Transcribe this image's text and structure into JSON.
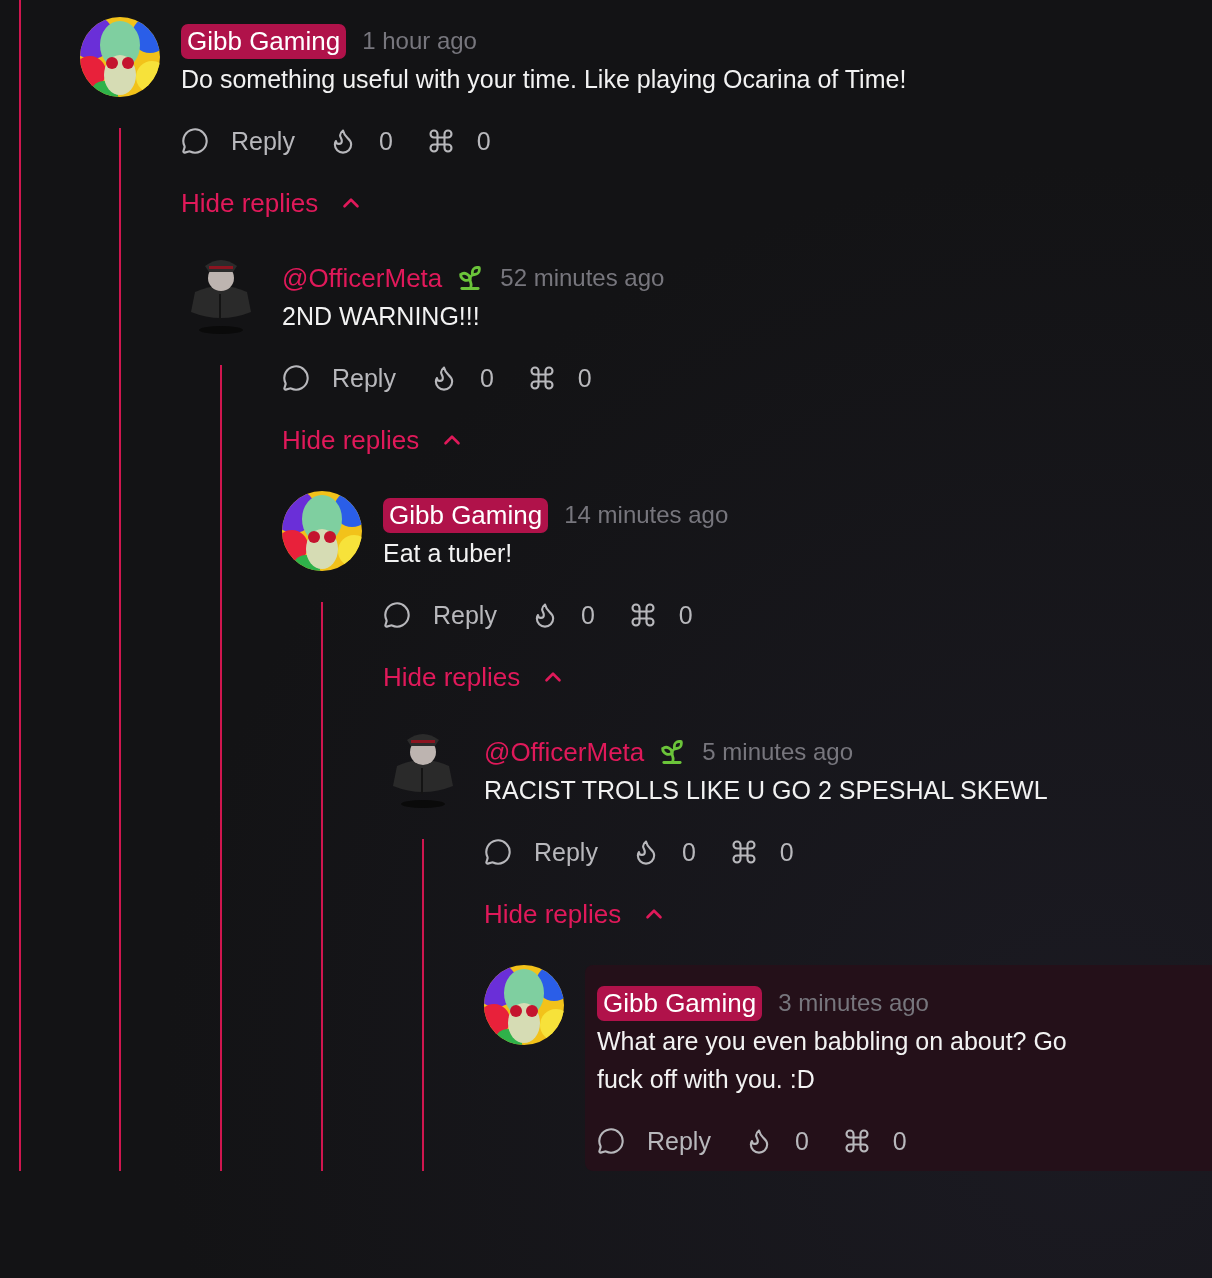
{
  "comments": [
    {
      "author": "Gibb Gaming",
      "kind": "op",
      "time": "1 hour ago",
      "text": "Do something useful with your time. Like playing Ocarina of Time!",
      "reply_label": "Reply",
      "flames": "0",
      "commands": "0",
      "highlighted": false,
      "toggle": {
        "label": "Hide replies",
        "expanded": true
      },
      "children": [
        {
          "author": "@OfficerMeta",
          "kind": "newcomer",
          "time": "52 minutes ago",
          "text": "2ND WARNING!!!",
          "reply_label": "Reply",
          "flames": "0",
          "commands": "0",
          "highlighted": false,
          "toggle": {
            "label": "Hide replies",
            "expanded": true
          },
          "children": [
            {
              "author": "Gibb Gaming",
              "kind": "op",
              "time": "14 minutes ago",
              "text": "Eat a tuber!",
              "reply_label": "Reply",
              "flames": "0",
              "commands": "0",
              "highlighted": false,
              "toggle": {
                "label": "Hide replies",
                "expanded": true
              },
              "children": [
                {
                  "author": "@OfficerMeta",
                  "kind": "newcomer",
                  "time": "5 minutes ago",
                  "text": "RACIST TROLLS LIKE U GO 2 SPESHAL SKEWL",
                  "reply_label": "Reply",
                  "flames": "0",
                  "commands": "0",
                  "highlighted": false,
                  "toggle": {
                    "label": "Hide replies",
                    "expanded": true
                  },
                  "children": [
                    {
                      "author": "Gibb Gaming",
                      "kind": "op",
                      "time": "3 minutes ago",
                      "text": "What are you even babbling on about? Go fuck off with you. :D",
                      "reply_label": "Reply",
                      "flames": "0",
                      "commands": "0",
                      "highlighted": true
                    }
                  ]
                }
              ]
            }
          ]
        }
      ]
    }
  ]
}
